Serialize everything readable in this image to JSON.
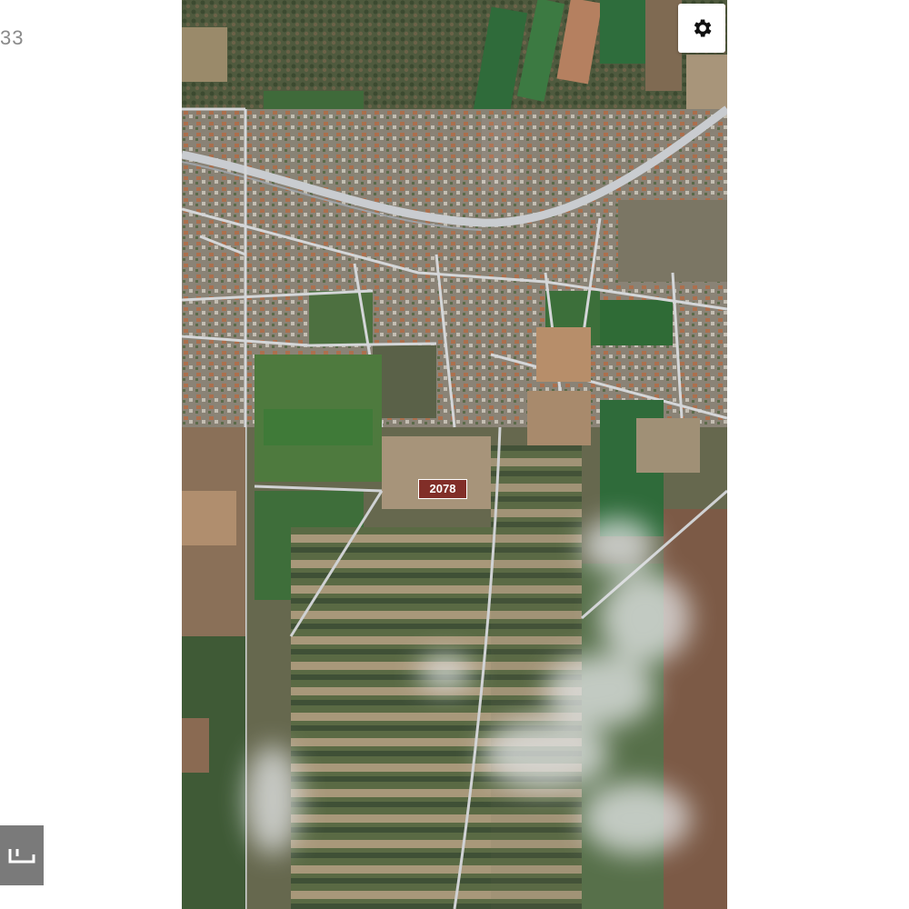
{
  "left_edge_text": "33",
  "map": {
    "type": "satellite",
    "parcel_label": "2078",
    "settings_icon": "gear-icon",
    "left_button_icon": "map-logo-icon"
  }
}
